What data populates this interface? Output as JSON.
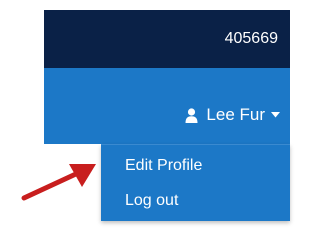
{
  "header": {
    "account_id": "405669"
  },
  "user_menu": {
    "user_icon": "user-icon",
    "name": "Lee Fur",
    "caret_icon": "caret-down-icon"
  },
  "dropdown": {
    "items": [
      {
        "label": "Edit Profile"
      },
      {
        "label": "Log out"
      }
    ]
  },
  "annotation": {
    "arrow_icon": "red-arrow-icon",
    "color": "#c81e1e"
  },
  "colors": {
    "top_bar": "#0a2147",
    "nav_bar": "#1c78c7",
    "text": "#ffffff"
  }
}
